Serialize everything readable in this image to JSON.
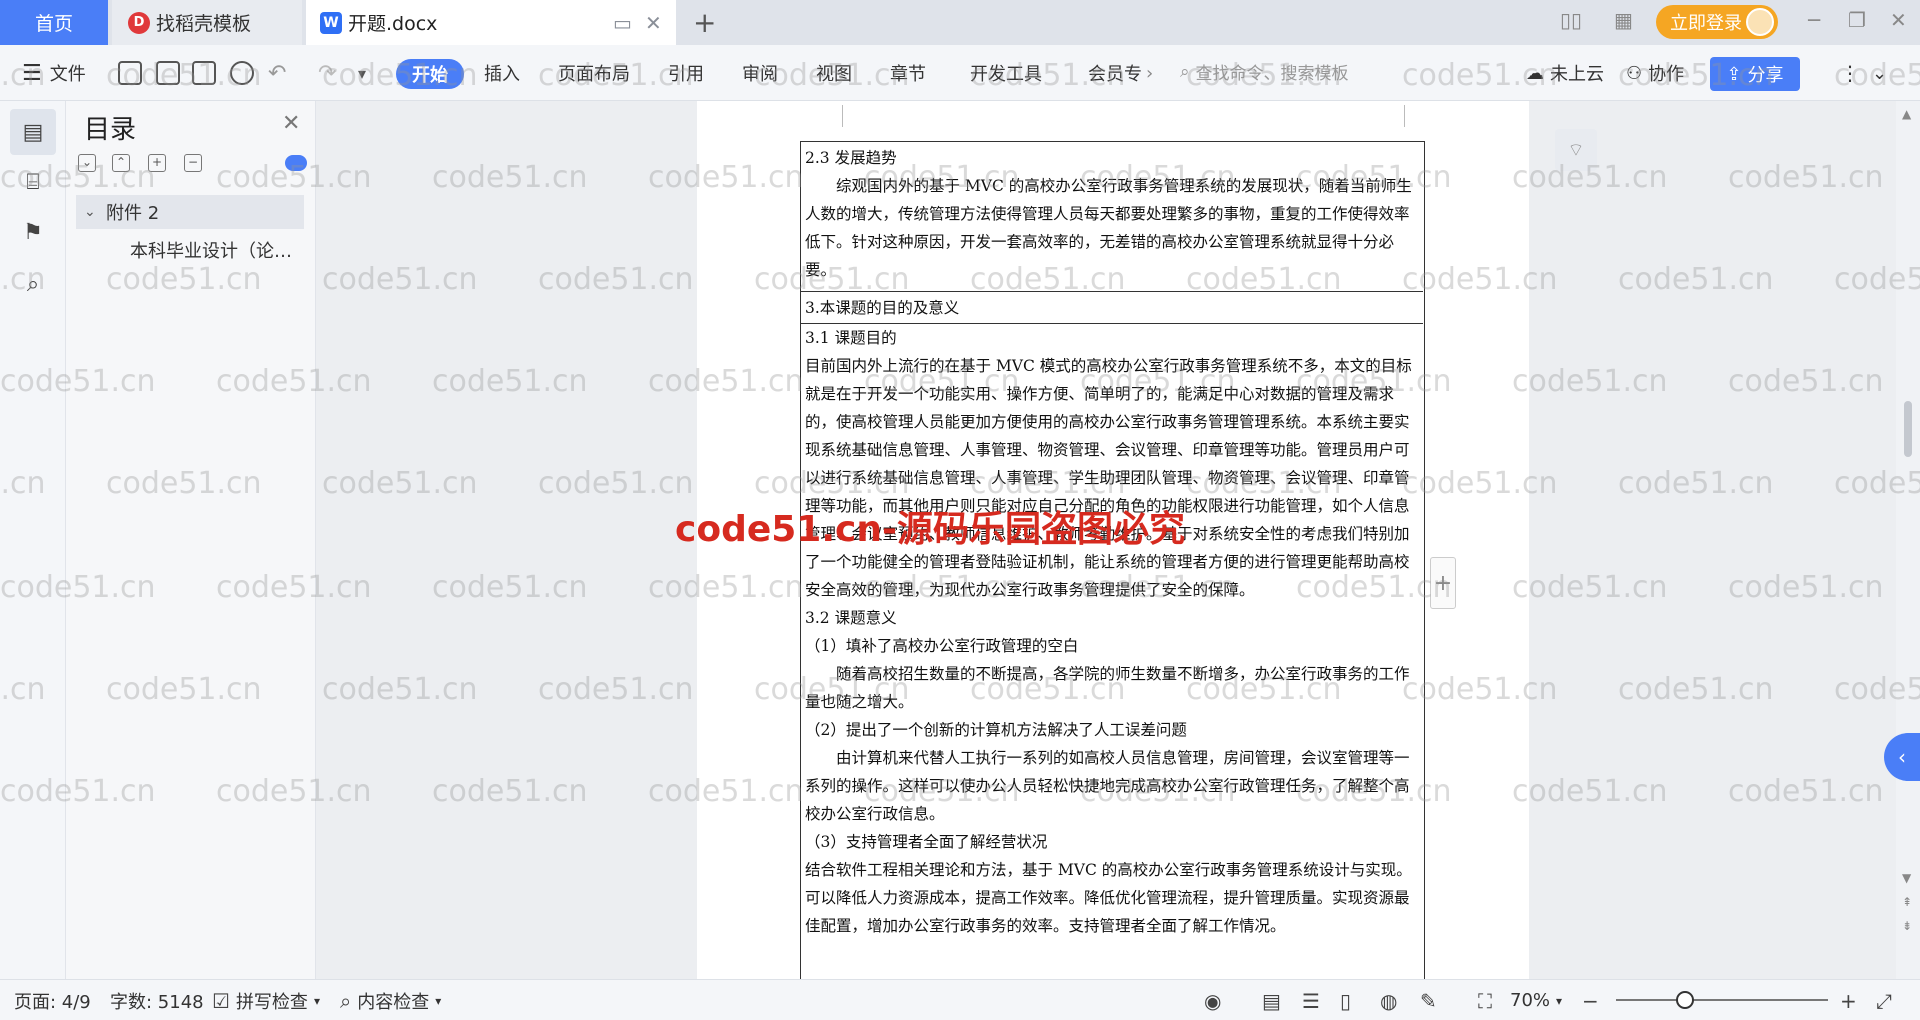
{
  "tabs": {
    "home": "首页",
    "daoke": "找稻壳模板",
    "doc": "开题.docx"
  },
  "topbar": {
    "login": "立即登录"
  },
  "ribbon": {
    "file": "文件",
    "items": [
      "开始",
      "插入",
      "页面布局",
      "引用",
      "审阅",
      "视图",
      "章节",
      "开发工具",
      "会员专"
    ],
    "search_placeholder": "查找命令、搜索模板",
    "cloud": "未上云",
    "collab": "协作",
    "share": "分享"
  },
  "toc": {
    "title": "目录",
    "item_level1": "附件 2",
    "item_level2": "本科毕业设计（论…"
  },
  "document": {
    "s23_heading": "2.3 发展趋势",
    "s23_body": "综观国内外的基于 MVC 的高校办公室行政事务管理系统的发展现状，随着当前师生人数的增大，传统管理方法使得管理人员每天都要处理繁多的事物，重复的工作使得效率低下。针对这种原因，开发一套高效率的，无差错的高校办公室管理系统就显得十分必要。",
    "s3_heading": "3.本课题的目的及意义",
    "s31_heading": "3.1 课题目的",
    "s31_body": "目前国内外上流行的在基于 MVC 模式的高校办公室行政事务管理系统不多，本文的目标就是在于开发一个功能实用、操作方便、简单明了的，能满足中心对数据的管理及需求的，使高校管理人员能更加方便使用的高校办公室行政事务管理管理系统。本系统主要实现系统基础信息管理、人事管理、物资管理、会议管理、印章管理等功能。管理员用户可以进行系统基础信息管理、人事管理、学生助理团队管理、物资管理、会议管理、印章管理等功能，而其他用户则只能对应自己分配的角色的功能权限进行功能管理，如个人信息管理、会议室预约、教师信息维护、教师考勤维护。基于对系统安全性的考虑我们特别加了一个功能健全的管理者登陆验证机制，能让系统的管理者方便的进行管理更能帮助高校安全高效的管理，为现代办公室行政事务管理提供了安全的保障。",
    "s32_heading": "3.2 课题意义",
    "p1_heading": "（1）填补了高校办公室行政管理的空白",
    "p1_body": "随着高校招生数量的不断提高，各学院的师生数量不断增多，办公室行政事务的工作量也随之增大。",
    "p2_heading": "（2）提出了一个创新的计算机方法解决了人工误差问题",
    "p2_body": "由计算机来代替人工执行一系列的如高校人员信息管理，房间管理，会议室管理等一系列的操作。这样可以使办公人员轻松快捷地完成高校办公室行政管理任务，了解整个高校办公室行政信息。",
    "p3_heading": "（3）支持管理者全面了解经营状况",
    "p3_body": "结合软件工程相关理论和方法，基于 MVC 的高校办公室行政事务管理系统设计与实现。可以降低人力资源成本，提高工作效率。降低优化管理流程，提升管理质量。实现资源最佳配置，增加办公室行政事务的效率。支持管理者全面了解工作情况。"
  },
  "watermark": {
    "text": "code51.cn",
    "red_text": "code51.cn-源码乐园盗图必究"
  },
  "status": {
    "page": "页面: 4/9",
    "words": "字数: 5148",
    "spell": "拼写检查",
    "content": "内容检查",
    "zoom": "70%"
  }
}
